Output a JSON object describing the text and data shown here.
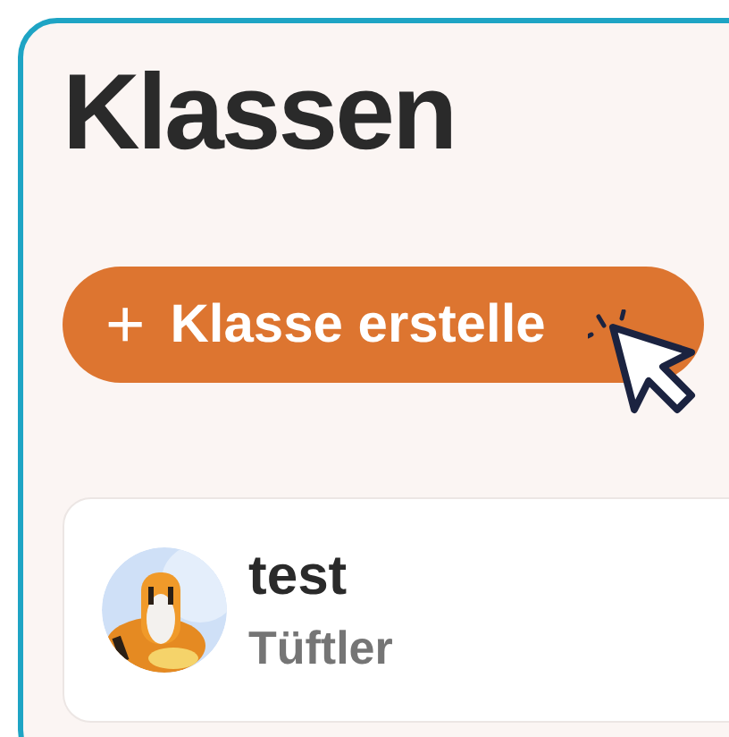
{
  "heading": "Klassen",
  "create_button": {
    "icon": "+",
    "label": "Klasse erstelle"
  },
  "classes": [
    {
      "name": "test",
      "level": "Tüftler"
    }
  ]
}
